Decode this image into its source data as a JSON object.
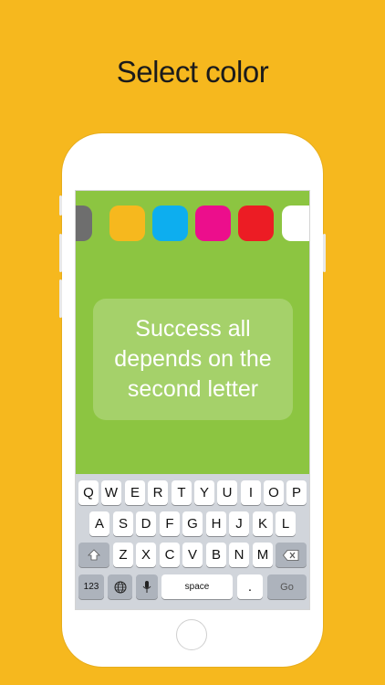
{
  "headline": "Select color",
  "swatches": [
    {
      "name": "gray",
      "color": "#6E6E6E"
    },
    {
      "name": "orange",
      "color": "#F6B81E"
    },
    {
      "name": "blue",
      "color": "#0DAEEF"
    },
    {
      "name": "magenta",
      "color": "#EC0E8C"
    },
    {
      "name": "red",
      "color": "#EC1C24"
    },
    {
      "name": "white",
      "color": "#FFFFFF"
    }
  ],
  "quote": "Success all depends on the second letter",
  "keyboard": {
    "row1": [
      "Q",
      "W",
      "E",
      "R",
      "T",
      "Y",
      "U",
      "I",
      "O",
      "P"
    ],
    "row2": [
      "A",
      "S",
      "D",
      "F",
      "G",
      "H",
      "J",
      "K",
      "L"
    ],
    "row3": [
      "Z",
      "X",
      "C",
      "V",
      "B",
      "N",
      "M"
    ],
    "numbers_key": "123",
    "space_key": "space",
    "period_key": ".",
    "go_key": "Go"
  }
}
